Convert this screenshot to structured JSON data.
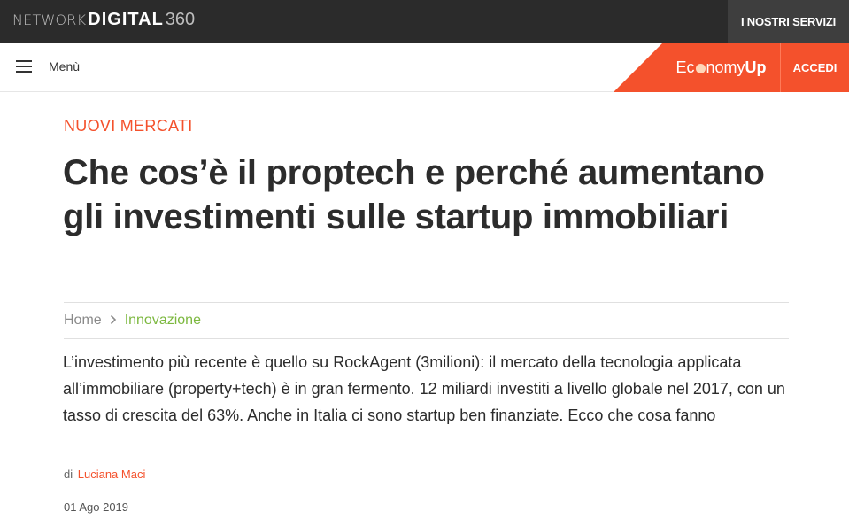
{
  "topbar": {
    "logo_network": "NETWORK",
    "logo_digital": "DIGITAL",
    "logo_360": "360",
    "services_label": "I NOSTRI SERVIZI"
  },
  "navbar": {
    "menu_label": "Menù",
    "brand_part1": "Ec",
    "brand_part2": "nomy",
    "brand_part3": "Up",
    "login_label": "ACCEDI"
  },
  "article": {
    "category": "NUOVI MERCATI",
    "title": "Che cos’è il proptech e perché aumentano gli investimenti sulle startup immobiliari",
    "breadcrumb": {
      "home": "Home",
      "section": "Innovazione"
    },
    "lead": "L’investimento più recente è quello su RockAgent (3milioni): il mercato della tecnologia applicata all’immobiliare (property+tech) è in gran fermento. 12 miliardi investiti a livello globale nel 2017, con un tasso di crescita del 63%. Anche in Italia ci sono startup ben finanziate. Ecco che cosa fanno",
    "byline_prefix": "di",
    "author": "Luciana Maci",
    "date": "01 Ago 2019"
  },
  "colors": {
    "accent": "#f4512c",
    "section_green": "#7cb83f",
    "topbar_bg": "#2b2b2b"
  }
}
